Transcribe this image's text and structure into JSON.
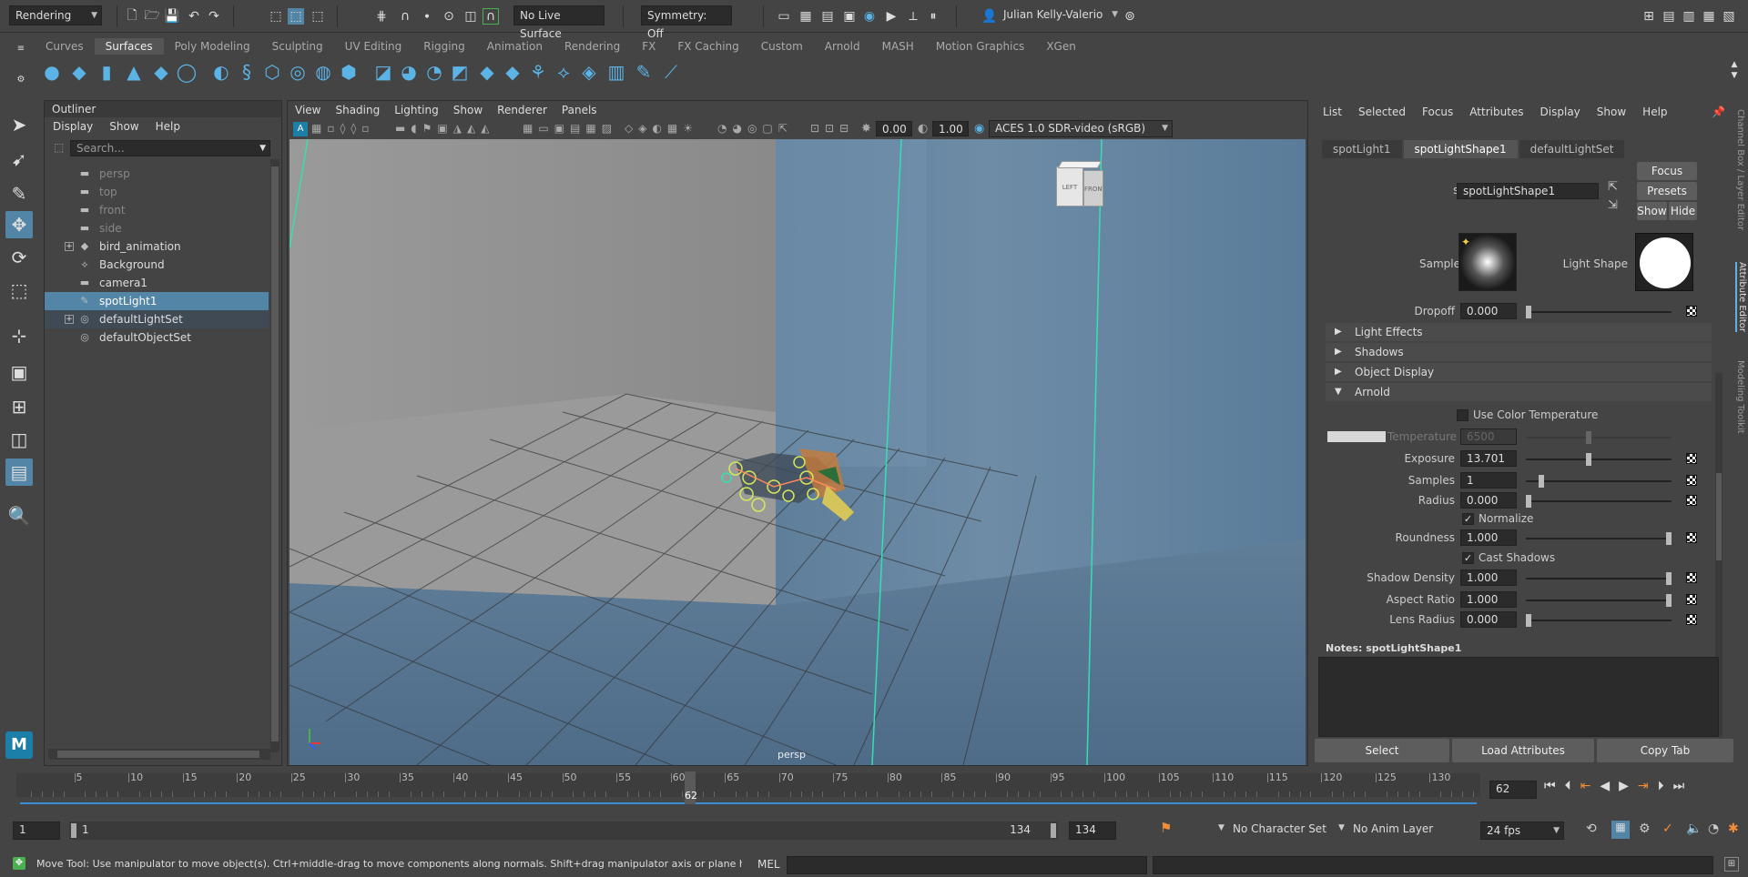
{
  "status_line": {
    "menu_set": "Rendering",
    "live_surface": "No Live Surface",
    "symmetry": "Symmetry: Off",
    "user": "Julian Kelly-Valerio"
  },
  "shelf_tabs": [
    "Curves",
    "Surfaces",
    "Poly Modeling",
    "Sculpting",
    "UV Editing",
    "Rigging",
    "Animation",
    "Rendering",
    "FX",
    "FX Caching",
    "Custom",
    "Arnold",
    "MASH",
    "Motion Graphics",
    "XGen"
  ],
  "shelf_active_tab": "Surfaces",
  "outliner": {
    "title": "Outliner",
    "menu": [
      "Display",
      "Show",
      "Help"
    ],
    "search_placeholder": "Search...",
    "items": [
      {
        "label": "persp",
        "state": "dim"
      },
      {
        "label": "top",
        "state": "dim"
      },
      {
        "label": "front",
        "state": "dim"
      },
      {
        "label": "side",
        "state": "dim"
      },
      {
        "label": "bird_animation",
        "state": "normal"
      },
      {
        "label": "Background",
        "state": "normal"
      },
      {
        "label": "camera1",
        "state": "normal"
      },
      {
        "label": "spotLight1",
        "state": "selected"
      },
      {
        "label": "defaultLightSet",
        "state": "highlight"
      },
      {
        "label": "defaultObjectSet",
        "state": "normal"
      }
    ]
  },
  "viewport": {
    "menu": [
      "View",
      "Shading",
      "Lighting",
      "Show",
      "Renderer",
      "Panels"
    ],
    "exposure": "0.00",
    "gamma": "1.00",
    "color_space": "ACES 1.0 SDR-video (sRGB)",
    "camera_label": "persp",
    "viewcube_left": "LEFT",
    "viewcube_front": "FRONT"
  },
  "attribute_editor": {
    "menu": [
      "List",
      "Selected",
      "Focus",
      "Attributes",
      "Display",
      "Show",
      "Help"
    ],
    "tabs": [
      "spotLight1",
      "spotLightShape1",
      "defaultLightSet"
    ],
    "active_tab": "spotLightShape1",
    "node_label": "spotLight:",
    "node_name": "spotLightShape1",
    "focus_btn": "Focus",
    "presets_btn": "Presets",
    "show_btn": "Show",
    "hide_btn": "Hide",
    "sample_label": "Sample",
    "light_shape_label": "Light Shape",
    "dropoff_label": "Dropoff",
    "dropoff": "0.000",
    "sections": [
      "Light Effects",
      "Shadows",
      "Object Display",
      "Arnold"
    ],
    "use_color_temperature": "Use Color Temperature",
    "temperature_label": "Temperature",
    "temperature": "6500",
    "exposure_label": "Exposure",
    "exposure": "13.701",
    "samples_label": "Samples",
    "samples": "1",
    "radius_label": "Radius",
    "radius": "0.000",
    "normalize": "Normalize",
    "roundness_label": "Roundness",
    "roundness": "1.000",
    "cast_shadows": "Cast Shadows",
    "shadow_density_label": "Shadow Density",
    "shadow_density": "1.000",
    "aspect_ratio_label": "Aspect Ratio",
    "aspect_ratio": "1.000",
    "lens_radius_label": "Lens Radius",
    "lens_radius": "0.000",
    "notes_label": "Notes:  spotLightShape1",
    "select_btn": "Select",
    "load_attributes_btn": "Load Attributes",
    "copy_tab_btn": "Copy Tab",
    "side_tabs": [
      "Channel Box / Layer Editor",
      "Attribute Editor",
      "Modeling Toolkit"
    ]
  },
  "time_slider": {
    "ticks": [
      "5",
      "10",
      "15",
      "20",
      "25",
      "30",
      "35",
      "40",
      "45",
      "50",
      "55",
      "60",
      "65",
      "70",
      "75",
      "80",
      "85",
      "90",
      "95",
      "100",
      "105",
      "110",
      "115",
      "120",
      "125",
      "130"
    ],
    "current_frame_marker": "62",
    "current_frame": "62"
  },
  "range_slider": {
    "start": "1",
    "inner_start": "1",
    "inner_end": "134",
    "end": "134",
    "character_set": "No Character Set",
    "anim_layer": "No Anim Layer",
    "fps": "24 fps"
  },
  "command_line": {
    "help_text": "Move Tool: Use manipulator to move object(s). Ctrl+middle-drag to move components along normals. Shift+drag manipulator axis or plane handles to extrude components or c",
    "language": "MEL"
  },
  "logo_text": "M"
}
